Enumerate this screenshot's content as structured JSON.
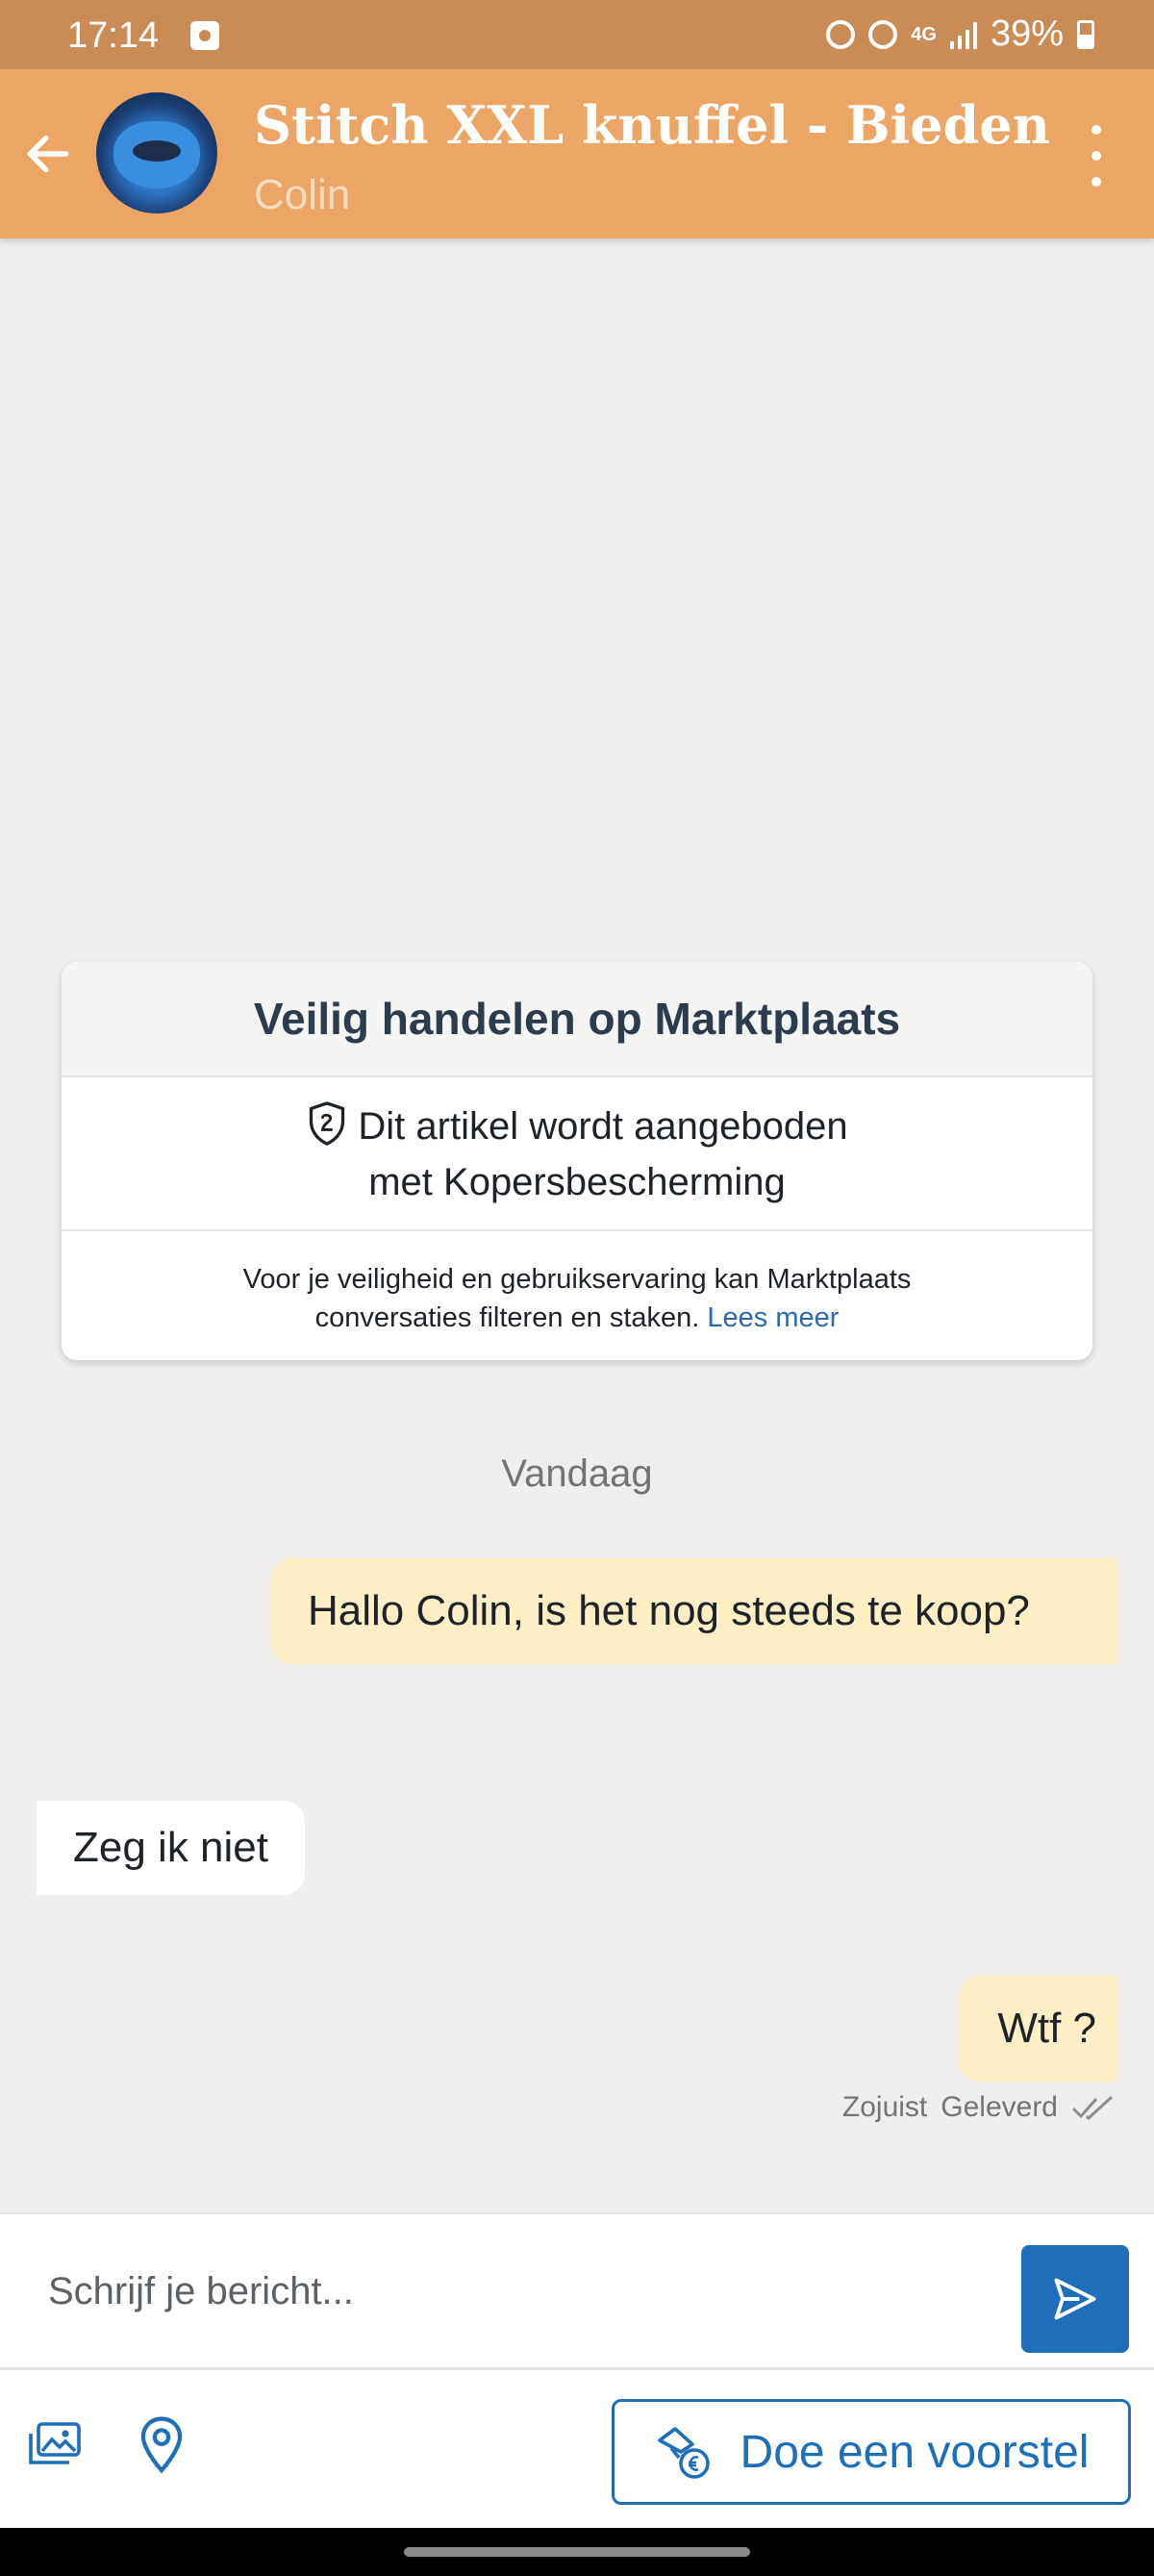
{
  "status_bar": {
    "time": "17:14",
    "network": "4G",
    "battery": "39%"
  },
  "header": {
    "title": "Stitch XXL knuffel - Bieden",
    "subtitle": "Colin"
  },
  "safety_card": {
    "title": "Veilig handelen op Marktplaats",
    "protection_line1": "Dit artikel wordt aangeboden",
    "protection_line2": "met Kopersbescherming",
    "notice_line1": "Voor je veiligheid en gebruikservaring kan Marktplaats",
    "notice_line2": "conversaties filteren en staken.",
    "link": "Lees meer"
  },
  "date_separator": "Vandaag",
  "messages": [
    {
      "direction": "out",
      "text": "Hallo Colin, is het nog steeds te koop?"
    },
    {
      "direction": "in",
      "text": "Zeg ik niet"
    },
    {
      "direction": "out",
      "text": "Wtf ?"
    }
  ],
  "last_message_meta": {
    "time": "Zojuist",
    "status": "Geleverd"
  },
  "composer": {
    "placeholder": "Schrijf je bericht..."
  },
  "toolbar": {
    "offer_label": "Doe een voorstel"
  },
  "colors": {
    "header": "#eca564",
    "status_bar": "#cb8b55",
    "accent_blue": "#1e6eb9",
    "outgoing_bubble": "#fcefc6"
  }
}
